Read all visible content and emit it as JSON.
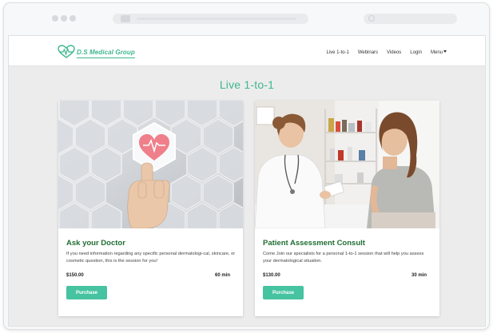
{
  "site": {
    "logo_text": "D.S Medical Group",
    "nav": [
      {
        "label": "Live 1-to-1"
      },
      {
        "label": "Webinars"
      },
      {
        "label": "Videos"
      },
      {
        "label": "Login"
      },
      {
        "label": "Menu"
      }
    ],
    "heading": "Live 1-to-1"
  },
  "cards": [
    {
      "title": "Ask your Doctor",
      "description": "If you need information regarding any specific personal dermatologi-cal, skincare, or cosmetic question, this is the session for you!",
      "price": "$150.00",
      "duration": "60 min",
      "button_label": "Purchase"
    },
    {
      "title": "Patient Assessment Consult",
      "description": "Come Join our specialists for a personal 1-to-1 session that will help you assess your dermatological situation.",
      "price": "$130.00",
      "duration": "30 min",
      "button_label": "Purchase"
    }
  ],
  "colors": {
    "brand_green": "#3fb78d",
    "button_teal": "#46c3a0",
    "title_green": "#1f6e32",
    "heart_pink": "#ef7f8a"
  },
  "icons": {
    "logo": "heart-pulse-icon",
    "menu_caret": "caret-down-icon"
  }
}
